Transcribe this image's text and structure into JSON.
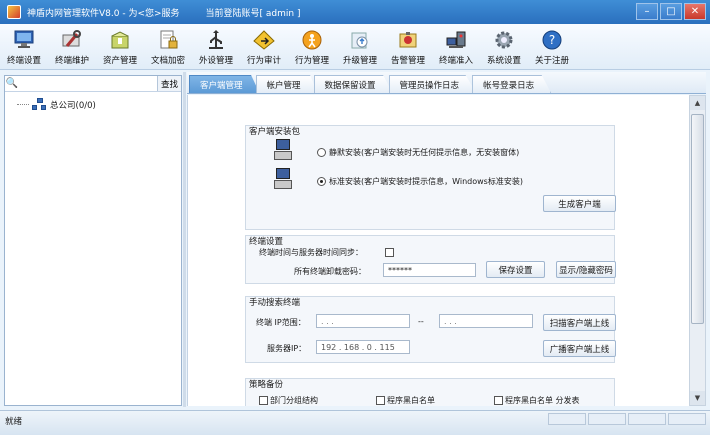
{
  "window": {
    "title": "神盾内网管理软件V8.0 - 为<您>服务",
    "account": "当前登陆账号[ admin ]",
    "controls": [
      "–",
      "□",
      "✕"
    ]
  },
  "toolbar": {
    "items": [
      {
        "label": "终端设置",
        "icon": "monitor-icon"
      },
      {
        "label": "终端维护",
        "icon": "wrench-icon"
      },
      {
        "label": "资产管理",
        "icon": "box-icon"
      },
      {
        "label": "文档加密",
        "icon": "encrypted-document-icon"
      },
      {
        "label": "外设管理",
        "icon": "usb-icon"
      },
      {
        "label": "行为审计",
        "icon": "audit-icon"
      },
      {
        "label": "行为管理",
        "icon": "behavior-icon"
      },
      {
        "label": "升级管理",
        "icon": "upgrade-icon"
      },
      {
        "label": "告警管理",
        "icon": "alarm-icon"
      },
      {
        "label": "终端准入",
        "icon": "network-access-icon"
      },
      {
        "label": "系统设置",
        "icon": "gear-icon"
      },
      {
        "label": "关于注册",
        "icon": "help-icon"
      }
    ]
  },
  "left_panel": {
    "search_placeholder": "",
    "search_button": "查找",
    "tree_root": "总公司(0/0)"
  },
  "tabs": [
    "客户端管理",
    "帐户管理",
    "数据保留设置",
    "管理员操作日志",
    "帐号登录日志"
  ],
  "active_tab": "客户端管理",
  "client_package": {
    "title": "客户端安装包",
    "silent_install": "静默安装(客户端安装时无任何提示信息，无安装窗体)",
    "standard_install": "标准安装(客户端安装时提示信息，Windows标准安装)",
    "selected": "standard",
    "generate_button": "生成客户端"
  },
  "terminal_settings": {
    "title": "终端设置",
    "time_sync_label": "终端时间与服务器时间同步：",
    "time_sync_checked": false,
    "uninstall_password_label": "所有终端卸载密码：",
    "uninstall_password_value": "******",
    "save_button": "保存设置",
    "toggle_password_button": "显示/隐藏密码"
  },
  "manual_search": {
    "title": "手动搜索终端",
    "ip_range_label": "终端 IP范围：",
    "ip_start": ".     .     .",
    "ip_separator": "--",
    "ip_end": ".     .     .",
    "scan_button": "扫描客户端上线",
    "server_ip_label": "服务器IP：",
    "server_ip_value": "192 . 168 . 0 . 115",
    "broadcast_button": "广播客户端上线"
  },
  "policy_backup": {
    "title": "策略备份",
    "options": [
      "部门分组结构",
      "程序黑白名单",
      "程序黑白名单 分发表"
    ]
  },
  "status_bar": {
    "text": "就绪"
  }
}
